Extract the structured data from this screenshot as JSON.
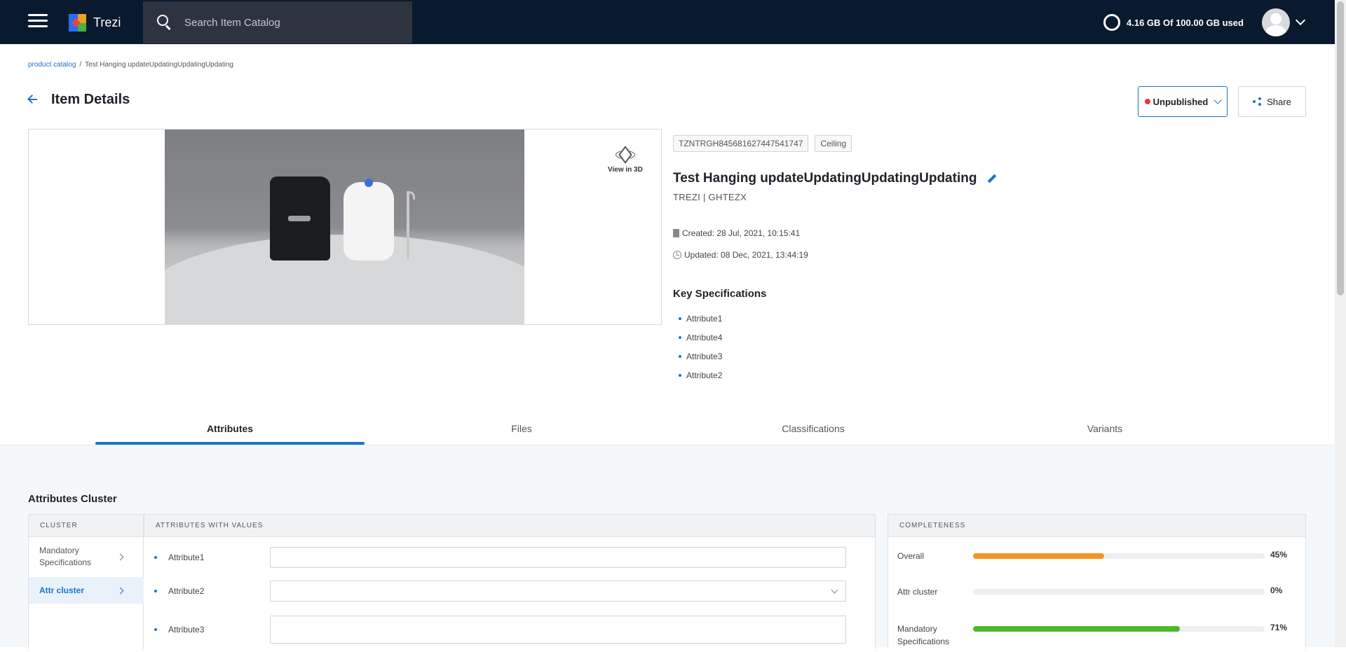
{
  "app": {
    "name": "Trezi"
  },
  "search": {
    "placeholder": "Search Item Catalog"
  },
  "storage": {
    "text": "4.16 GB Of 100.00 GB used"
  },
  "breadcrumb": {
    "root": "product catalog",
    "separator": "/",
    "current": "Test Hanging updateUpdatingUpdatingUpdating"
  },
  "page": {
    "title": "Item Details"
  },
  "actions": {
    "status_label": "Unpublished",
    "share_label": "Share"
  },
  "preview": {
    "view3d_label": "View in 3D"
  },
  "item": {
    "tags": [
      "TZNTRGH845681627447541747",
      "Ceiling"
    ],
    "title": "Test Hanging updateUpdatingUpdatingUpdating",
    "brand": "TREZI | GHTEZX",
    "created": "Created: 28 Jul, 2021, 10:15:41",
    "updated": "Updated: 08 Dec, 2021, 13:44:19"
  },
  "key_specs": {
    "title": "Key Specifications",
    "items": [
      "Attribute1",
      "Attribute4",
      "Attribute3",
      "Attribute2"
    ]
  },
  "tabs": [
    "Attributes",
    "Files",
    "Classifications",
    "Variants"
  ],
  "active_tab": "Attributes",
  "attributes_cluster": {
    "title": "Attributes Cluster",
    "cluster_header": "CLUSTER",
    "attrs_header": "ATTRIBUTES WITH VALUES",
    "completeness_header": "COMPLETENESS",
    "clusters": [
      "Mandatory Specifications",
      "Attr cluster"
    ],
    "active_cluster": "Attr cluster",
    "attributes": [
      {
        "label": "Attribute1",
        "value": "",
        "type": "text"
      },
      {
        "label": "Attribute2",
        "value": "",
        "type": "select"
      },
      {
        "label": "Attribute3",
        "value": "",
        "type": "text"
      }
    ],
    "completeness": [
      {
        "label": "Overall",
        "value": "45%",
        "fraction": 0.45,
        "color": "#f7931e"
      },
      {
        "label": "Attr cluster",
        "value": "0%",
        "fraction": 0.0,
        "color": "#4cb82a"
      },
      {
        "label": "Mandatory Specifications",
        "value": "71%",
        "fraction": 0.71,
        "color": "#4cb82a"
      }
    ]
  },
  "colors": {
    "topbar": "#0a1a2e",
    "accent": "#1a73c7",
    "unpublished_dot": "#e53935"
  }
}
